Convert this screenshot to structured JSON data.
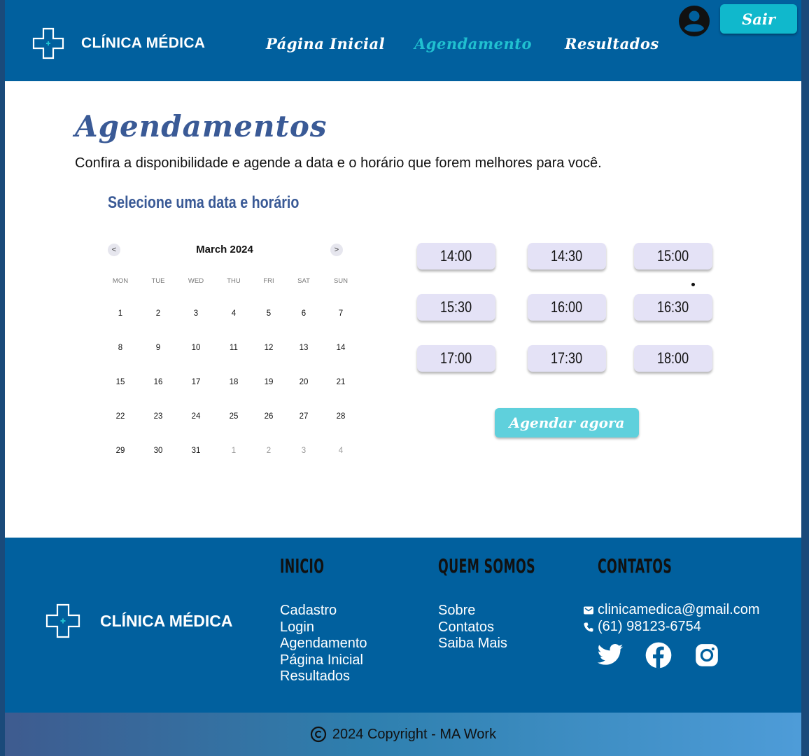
{
  "header": {
    "brand": "CLÍNICA MÉDICA",
    "nav": [
      {
        "label": "Página Inicial",
        "active": false
      },
      {
        "label": "Agendamento",
        "active": true
      },
      {
        "label": "Resultados",
        "active": false
      }
    ],
    "logout_label": "Sair",
    "icons": {
      "logo": "medical-cross-icon",
      "avatar": "user-avatar-icon"
    }
  },
  "main": {
    "title": "Agendamentos",
    "subtitle": "Confira a disponibilidade e agende a data e o horário que forem melhores para você.",
    "section_title": "Selecione uma data e horário",
    "calendar": {
      "month": "March 2024",
      "prev_label": "<",
      "next_label": ">",
      "weekdays": [
        "MON",
        "TUE",
        "WED",
        "THU",
        "FRI",
        "SAT",
        "SUN"
      ],
      "weeks": [
        [
          "1",
          "2",
          "3",
          "4",
          "5",
          "6",
          "7"
        ],
        [
          "8",
          "9",
          "10",
          "11",
          "12",
          "13",
          "14"
        ],
        [
          "15",
          "16",
          "17",
          "18",
          "19",
          "20",
          "21"
        ],
        [
          "22",
          "23",
          "24",
          "25",
          "26",
          "27",
          "28"
        ],
        [
          "29",
          "30",
          "31",
          "1",
          "2",
          "3",
          "4"
        ]
      ],
      "next_month_days_in_last_week": 4
    },
    "time_slots": [
      "14:00",
      "14:30",
      "15:00",
      "15:30",
      "16:00",
      "16:30",
      "17:00",
      "17:30",
      "18:00"
    ],
    "book_button": "Agendar agora"
  },
  "footer": {
    "brand": "CLÍNICA MÉDICA",
    "columns": [
      {
        "heading": "INICIO",
        "links": [
          "Cadastro",
          "Login",
          "Agendamento",
          "Página Inicial",
          "Resultados"
        ]
      },
      {
        "heading": "QUEM SOMOS",
        "links": [
          "Sobre",
          "Contatos",
          "Saiba Mais"
        ]
      },
      {
        "heading": "CONTATOS",
        "links": []
      }
    ],
    "email": "clinicamedica@gmail.com",
    "phone": "(61) 98123-6754",
    "social_icons": [
      "twitter-icon",
      "facebook-icon",
      "instagram-icon"
    ],
    "copyright": "2024 Copyright - MA Work"
  },
  "colors": {
    "primary": "#01609e",
    "accent": "#20c0d0",
    "button": "#10b8cc",
    "title": "#3a5a96",
    "slot_bg": "#e4e2f6"
  }
}
